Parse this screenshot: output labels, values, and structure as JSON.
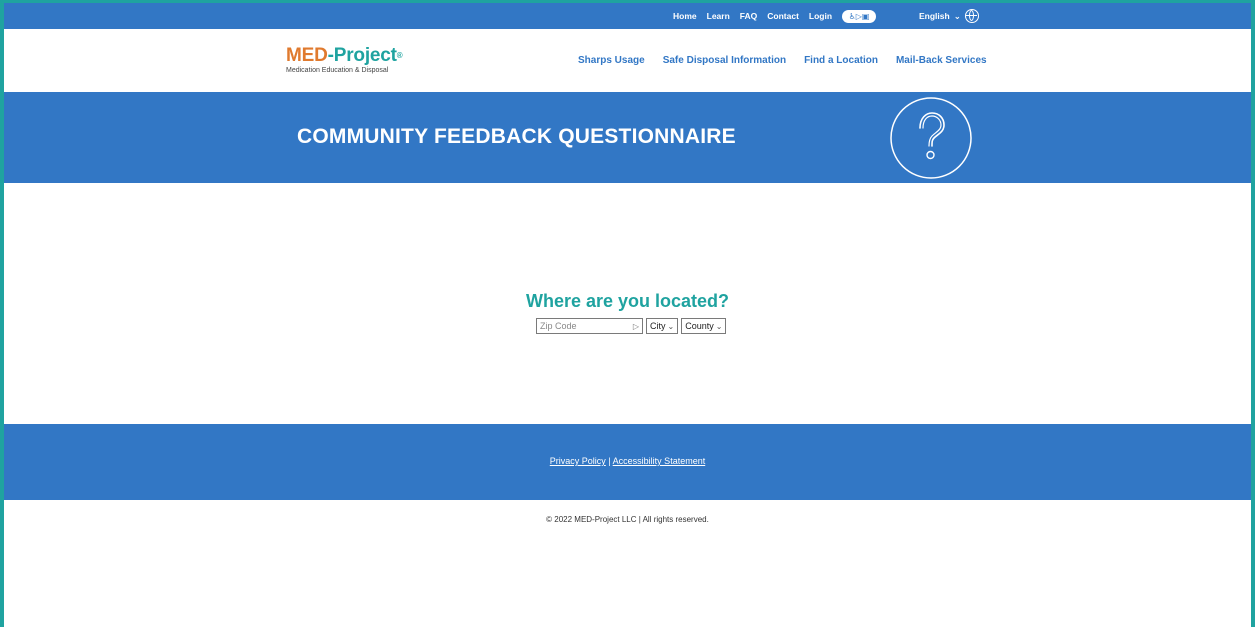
{
  "topbar": {
    "nav": [
      "Home",
      "Learn",
      "FAQ",
      "Contact",
      "Login"
    ],
    "accessibility_toggle": "♿▷▣",
    "language": "English",
    "language_chevron": "⌄",
    "globe_icon": "globe-icon"
  },
  "header": {
    "logo_med": "MED",
    "logo_dash": "-",
    "logo_project": "Project",
    "logo_reg": "®",
    "logo_subtitle": "Medication Education & Disposal",
    "nav": [
      "Sharps Usage",
      "Safe Disposal Information",
      "Find a Location",
      "Mail-Back Services"
    ]
  },
  "hero": {
    "title": "COMMUNITY FEEDBACK QUESTIONNAIRE",
    "icon": "question-mark-icon"
  },
  "main": {
    "question": "Where are you located?",
    "zip_placeholder": "Zip Code",
    "zip_go": "▷",
    "city_label": "City",
    "county_label": "County",
    "chevron": "⌄"
  },
  "footer": {
    "privacy_link": "Privacy Policy",
    "separator": "|",
    "accessibility_link": "Accessibility Statement",
    "copyright": "© 2022 MED-Project LLC | All rights reserved."
  },
  "colors": {
    "brand_blue": "#3277c5",
    "teal": "#1fa3a0",
    "orange": "#e07a2e"
  }
}
